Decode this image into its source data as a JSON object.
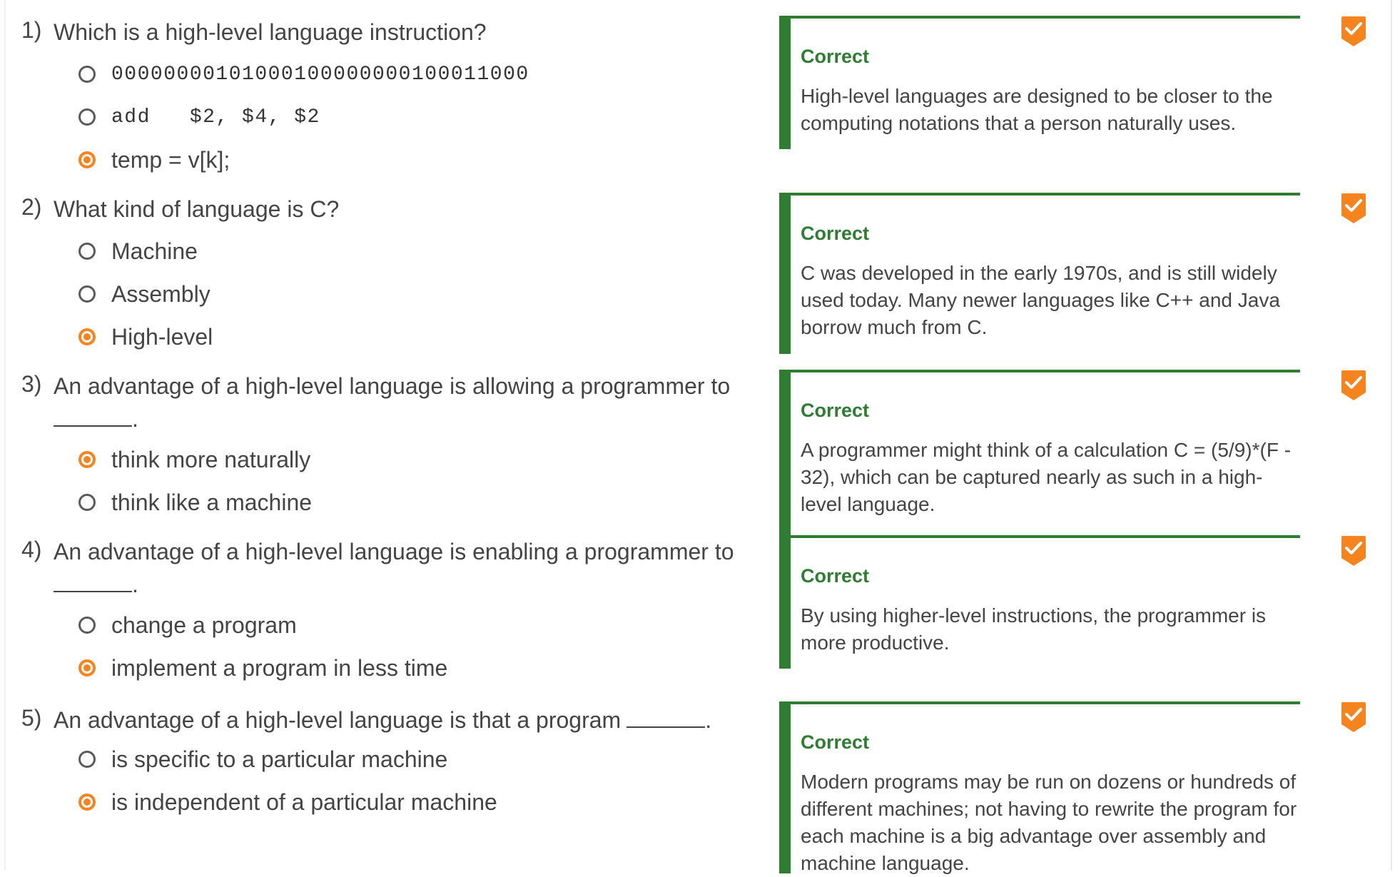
{
  "status_colors": {
    "correct": "#2e7d32",
    "selected": "#f5841f",
    "check_badge": "#f5841f"
  },
  "questions": [
    {
      "number": "1)",
      "text": "Which is a high-level language instruction?",
      "options": [
        {
          "label": "00000000101000100000000100011000",
          "selected": false,
          "mono": true
        },
        {
          "label": "add   $2, $4, $2",
          "selected": false,
          "mono": true
        },
        {
          "label": "temp = v[k];",
          "selected": true
        }
      ],
      "feedback": {
        "title": "Correct",
        "text": "High-level languages are designed to be closer to the computing notations that a person naturally uses."
      },
      "check_icon": "checkmark-badge-icon"
    },
    {
      "number": "2)",
      "text": "What kind of language is C?",
      "options": [
        {
          "label": "Machine",
          "selected": false
        },
        {
          "label": "Assembly",
          "selected": false
        },
        {
          "label": "High-level",
          "selected": true
        }
      ],
      "feedback": {
        "title": "Correct",
        "text": "C was developed in the early 1970s, and is still widely used today. Many newer languages like C++ and Java borrow much from C."
      },
      "check_icon": "checkmark-badge-icon"
    },
    {
      "number": "3)",
      "text": "An advantage of a high-level language is allowing a programmer to",
      "blank_suffix": ".",
      "options": [
        {
          "label": "think more naturally",
          "selected": true
        },
        {
          "label": "think like a machine",
          "selected": false
        }
      ],
      "feedback": {
        "title": "Correct",
        "text": "A programmer might think of a calculation C = (5/9)*(F - 32), which can be captured nearly as such in a high-level language."
      },
      "check_icon": "checkmark-badge-icon"
    },
    {
      "number": "4)",
      "text": "An advantage of a high-level language is enabling a programmer to",
      "blank_suffix": ".",
      "options": [
        {
          "label": "change a program",
          "selected": false
        },
        {
          "label": "implement a program in less time",
          "selected": true
        }
      ],
      "feedback": {
        "title": "Correct",
        "text": "By using higher-level instructions, the programmer is more productive."
      },
      "check_icon": "checkmark-badge-icon"
    },
    {
      "number": "5)",
      "text": "An advantage of a high-level language is that a program",
      "blank_suffix": ".",
      "options": [
        {
          "label": "is specific to a particular machine",
          "selected": false
        },
        {
          "label": "is independent of a particular machine",
          "selected": true
        }
      ],
      "feedback": {
        "title": "Correct",
        "text": "Modern programs may be run on dozens or hundreds of different machines; not having to rewrite the program for each machine is a big advantage over assembly and machine language."
      },
      "check_icon": "checkmark-badge-icon"
    }
  ]
}
